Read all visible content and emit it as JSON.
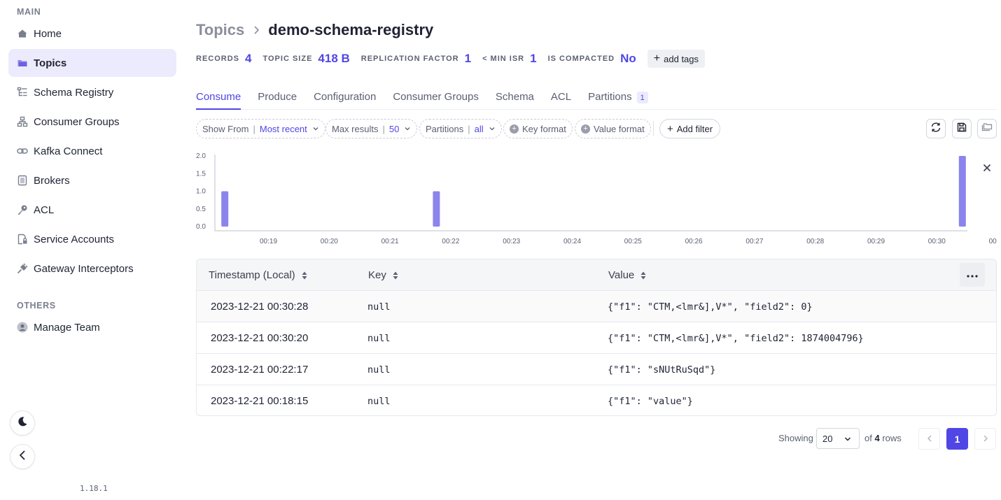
{
  "sidebar": {
    "main_label": "MAIN",
    "others_label": "OTHERS",
    "items": [
      {
        "label": "Home",
        "icon": "home-icon"
      },
      {
        "label": "Topics",
        "icon": "folder-icon",
        "active": true
      },
      {
        "label": "Schema Registry",
        "icon": "schema-icon"
      },
      {
        "label": "Consumer Groups",
        "icon": "consumer-groups-icon"
      },
      {
        "label": "Kafka Connect",
        "icon": "link-icon"
      },
      {
        "label": "Brokers",
        "icon": "broker-icon"
      },
      {
        "label": "ACL",
        "icon": "key-icon"
      },
      {
        "label": "Service Accounts",
        "icon": "service-account-icon"
      },
      {
        "label": "Gateway Interceptors",
        "icon": "plug-icon"
      }
    ],
    "others": [
      {
        "label": "Manage Team",
        "icon": "user-icon"
      }
    ],
    "version": "1.18.1"
  },
  "header": {
    "breadcrumb_parent": "Topics",
    "title": "demo-schema-registry"
  },
  "stats": {
    "records_label": "RECORDS",
    "records_value": "4",
    "size_label": "TOPIC SIZE",
    "size_value": "418 B",
    "replication_label": "REPLICATION FACTOR",
    "replication_value": "1",
    "minisr_label": "< MIN ISR",
    "minisr_value": "1",
    "compacted_label": "IS COMPACTED",
    "compacted_value": "No",
    "add_tags_label": "add tags"
  },
  "tabs": [
    {
      "label": "Consume",
      "active": true
    },
    {
      "label": "Produce"
    },
    {
      "label": "Configuration"
    },
    {
      "label": "Consumer Groups"
    },
    {
      "label": "Schema"
    },
    {
      "label": "ACL"
    },
    {
      "label": "Partitions",
      "badge": "1"
    }
  ],
  "filters": {
    "show_from_label": "Show From",
    "show_from_value": "Most recent",
    "max_results_label": "Max results",
    "max_results_value": "50",
    "partitions_label": "Partitions",
    "partitions_value": "all",
    "key_format_label": "Key format",
    "value_format_label": "Value format",
    "add_filter_label": "Add filter"
  },
  "chart_data": {
    "type": "bar",
    "title": "",
    "xlabel": "",
    "ylabel": "",
    "ylim": [
      0,
      2
    ],
    "y_ticks": [
      "0.0",
      "0.5",
      "1.0",
      "1.5",
      "2.0"
    ],
    "x_ticks": [
      "00:19",
      "00:20",
      "00:21",
      "00:22",
      "00:23",
      "00:24",
      "00:25",
      "00:26",
      "00:27",
      "00:28",
      "00:29",
      "00:30",
      "00"
    ],
    "bars": [
      {
        "time": "00:18",
        "value": 1
      },
      {
        "time": "00:22",
        "value": 1
      },
      {
        "time": "00:30",
        "value": 2
      }
    ],
    "bar_color": "#8b84ec"
  },
  "table": {
    "columns": [
      "Timestamp (Local)",
      "Key",
      "Value"
    ],
    "rows": [
      {
        "timestamp": "2023-12-21 00:30:28",
        "key": "null",
        "value": "{\"f1\": \"CTM,<lmr&],V*\", \"field2\": 0}"
      },
      {
        "timestamp": "2023-12-21 00:30:20",
        "key": "null",
        "value": "{\"f1\": \"CTM,<lmr&],V*\", \"field2\": 1874004796}"
      },
      {
        "timestamp": "2023-12-21 00:22:17",
        "key": "null",
        "value": "{\"f1\": \"sNUtRuSqd\"}"
      },
      {
        "timestamp": "2023-12-21 00:18:15",
        "key": "null",
        "value": "{\"f1\": \"value\"}"
      }
    ]
  },
  "pagination": {
    "showing_label": "Showing",
    "page_size": "20",
    "of_label": "of",
    "total_rows": "4",
    "rows_label": "rows",
    "current_page": "1"
  },
  "colors": {
    "accent": "#4f46e5",
    "active_nav_bg": "#ecebfd"
  }
}
